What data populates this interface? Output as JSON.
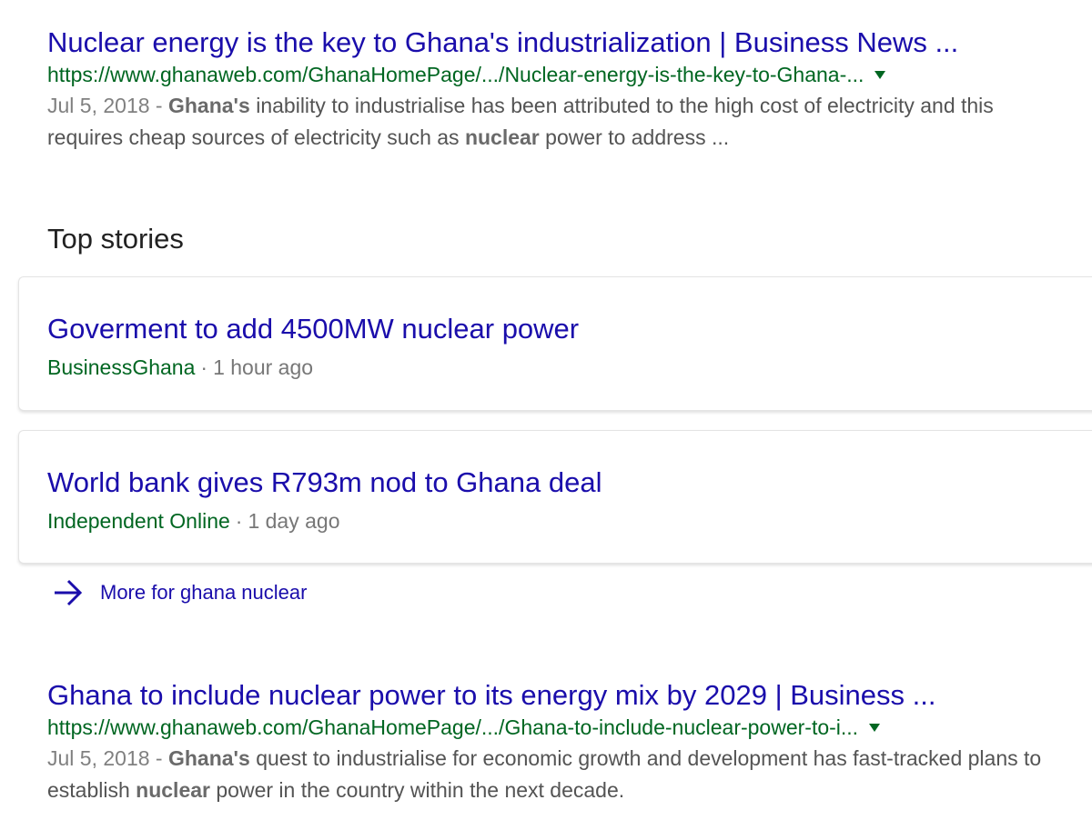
{
  "results": [
    {
      "title": "Nuclear energy is the key to Ghana's industrialization | Business News ...",
      "url": "https://www.ghanaweb.com/GhanaHomePage/.../Nuclear-energy-is-the-key-to-Ghana-...",
      "date": "Jul 5, 2018",
      "date_sep": " - ",
      "snippet_parts": [
        {
          "text": "Ghana's",
          "bold": true
        },
        {
          "text": " inability to industrialise has been attributed to the high cost of electricity and this requires cheap sources of electricity such as ",
          "bold": false
        },
        {
          "text": "nuclear",
          "bold": true
        },
        {
          "text": " power to address ...",
          "bold": false
        }
      ]
    },
    {
      "title": "Ghana to include nuclear power to its energy mix by 2029 | Business ...",
      "url": "https://www.ghanaweb.com/GhanaHomePage/.../Ghana-to-include-nuclear-power-to-i...",
      "date": "Jul 5, 2018",
      "date_sep": " - ",
      "snippet_parts": [
        {
          "text": "Ghana's",
          "bold": true
        },
        {
          "text": " quest to industrialise for economic growth and development has fast-tracked plans to establish ",
          "bold": false
        },
        {
          "text": "nuclear",
          "bold": true
        },
        {
          "text": " power in the country within the next decade.",
          "bold": false
        }
      ]
    }
  ],
  "top_stories": {
    "heading": "Top stories",
    "items": [
      {
        "title": "Goverment to add 4500MW nuclear power",
        "source": "BusinessGhana",
        "separator": "·",
        "time": "1 hour ago"
      },
      {
        "title": "World bank gives R793m nod to Ghana deal",
        "source": "Independent Online",
        "separator": "·",
        "time": "1 day ago"
      }
    ],
    "more_label": "More for ghana nuclear",
    "more_icon": "arrow-right-icon"
  },
  "colors": {
    "link": "#1a0dab",
    "url": "#006621",
    "snippet": "#545454"
  }
}
